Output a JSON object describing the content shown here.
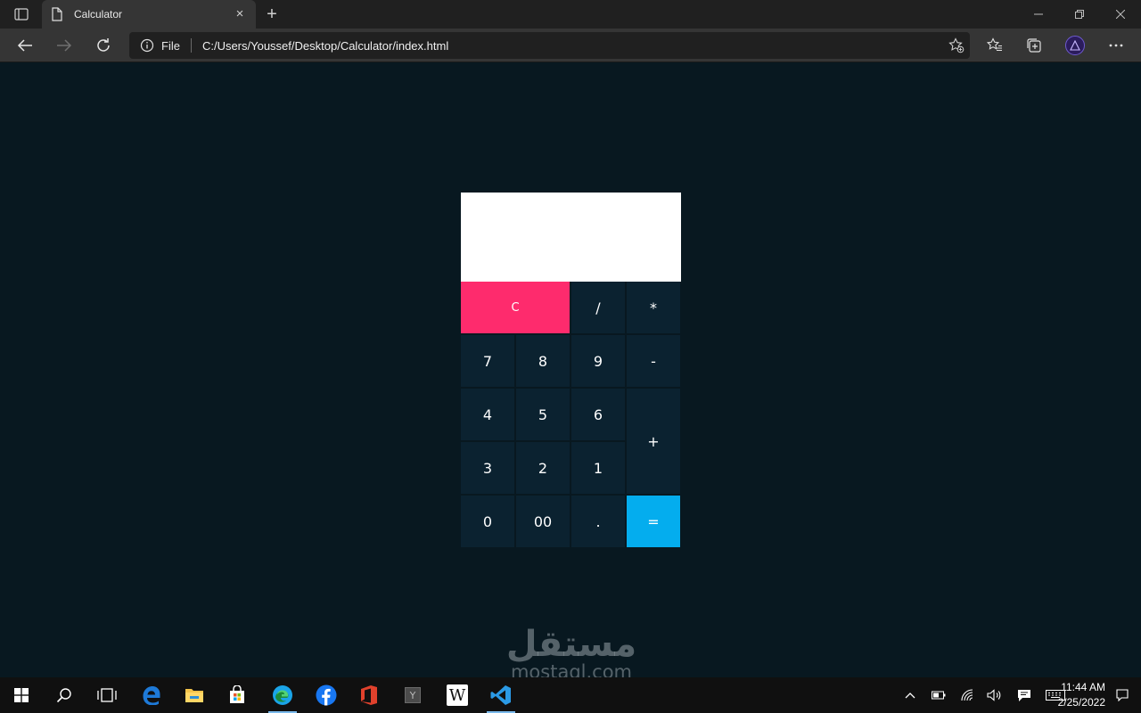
{
  "browser": {
    "tab_title": "Calculator",
    "address_scheme_label": "File",
    "url": "C:/Users/Youssef/Desktop/Calculator/index.html",
    "new_tab_label": "+",
    "tab_close_label": "×"
  },
  "calculator": {
    "display_value": "",
    "keys": [
      {
        "id": "clear",
        "label": "C"
      },
      {
        "id": "divide",
        "label": "/"
      },
      {
        "id": "multiply",
        "label": "*"
      },
      {
        "id": "seven",
        "label": "7"
      },
      {
        "id": "eight",
        "label": "8"
      },
      {
        "id": "nine",
        "label": "9"
      },
      {
        "id": "minus",
        "label": "-"
      },
      {
        "id": "four",
        "label": "4"
      },
      {
        "id": "five",
        "label": "5"
      },
      {
        "id": "six",
        "label": "6"
      },
      {
        "id": "plus",
        "label": "+"
      },
      {
        "id": "three",
        "label": "3"
      },
      {
        "id": "two",
        "label": "2"
      },
      {
        "id": "one",
        "label": "1"
      },
      {
        "id": "zero",
        "label": "0"
      },
      {
        "id": "double-zero",
        "label": "00"
      },
      {
        "id": "dot",
        "label": "."
      },
      {
        "id": "equals",
        "label": "="
      }
    ],
    "colors": {
      "clear": "#fe2b6d",
      "equals": "#04adee",
      "key": "#0b2230",
      "page_background": "#081820"
    }
  },
  "watermark": {
    "arabic": "مستقل",
    "latin": "mostaql.com"
  },
  "taskbar": {
    "apps": [
      "start-icon",
      "search-icon",
      "task-view-icon",
      "edge-legacy-icon",
      "file-explorer-icon",
      "store-icon",
      "edge-icon",
      "facebook-icon",
      "office-icon",
      "app-y-icon",
      "wikipedia-icon",
      "vscode-icon"
    ],
    "wikipedia_label": "W",
    "app_y_label": "Y",
    "time": "11:44 AM",
    "date": "2/25/2022"
  }
}
